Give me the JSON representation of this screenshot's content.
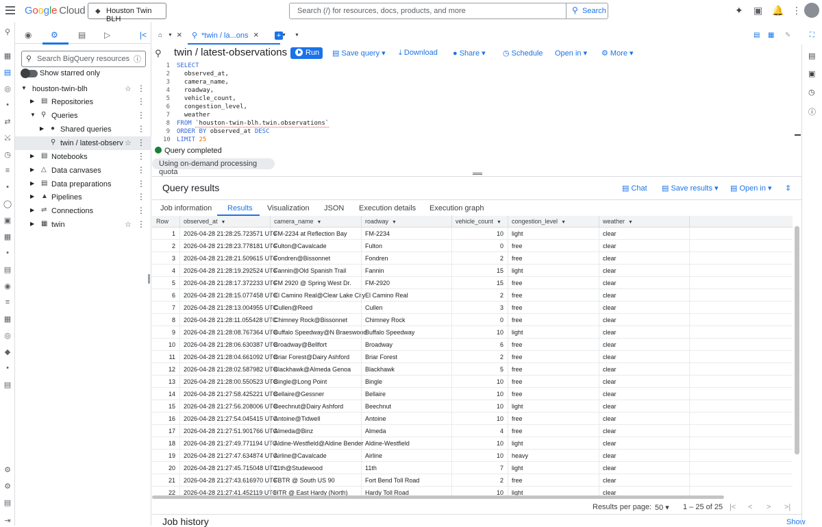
{
  "app": {
    "brand": "Google Cloud",
    "project_button": "Houston Twin BLH",
    "search_placeholder": "Search (/) for resources, docs, products, and more",
    "search_button": "Search"
  },
  "explorer": {
    "search_placeholder": "Search BigQuery resources",
    "show_starred": "Show starred only",
    "tree": [
      {
        "label": "houston-twin-blh",
        "starred": true
      },
      {
        "label": "Repositories"
      },
      {
        "label": "Queries"
      },
      {
        "label": "Shared queries"
      },
      {
        "label": "twin / latest-observatio",
        "starred": true,
        "selected": true
      },
      {
        "label": "Notebooks"
      },
      {
        "label": "Data canvases"
      },
      {
        "label": "Data preparations"
      },
      {
        "label": "Pipelines"
      },
      {
        "label": "Connections"
      },
      {
        "label": "twin",
        "starred": true
      }
    ]
  },
  "editor": {
    "tab_label": "*twin / la...ons",
    "query_title": "twin / latest-observations",
    "run": "Run",
    "save_query": "Save query",
    "download": "Download",
    "share": "Share",
    "schedule": "Schedule",
    "open_in": "Open in",
    "more": "More",
    "code": [
      "SELECT",
      "  observed_at,",
      "  camera_name,",
      "  roadway,",
      "  vehicle_count,",
      "  congestion_level,",
      "  weather",
      "FROM `houston-twin-blh.twin.observations`",
      "ORDER BY observed_at DESC",
      "LIMIT 25"
    ],
    "status": "Query completed",
    "quota": "Using on-demand processing quota"
  },
  "results": {
    "title": "Query results",
    "chat": "Chat",
    "save_results": "Save results",
    "open_in": "Open in",
    "tabs": [
      "Job information",
      "Results",
      "Visualization",
      "JSON",
      "Execution details",
      "Execution graph"
    ],
    "columns": [
      "Row",
      "observed_at",
      "camera_name",
      "roadway",
      "vehicle_count",
      "congestion_level",
      "weather"
    ],
    "rows": [
      [
        "1",
        "2026-04-28 21:28:25.723571 UTC",
        "FM-2234 at Reflection Bay",
        "FM-2234",
        "10",
        "light",
        "clear"
      ],
      [
        "2",
        "2026-04-28 21:28:23.778181 UTC",
        "Fulton@Cavalcade",
        "Fulton",
        "0",
        "free",
        "clear"
      ],
      [
        "3",
        "2026-04-28 21:28:21.509615 UTC",
        "Fondren@Bissonnet",
        "Fondren",
        "2",
        "free",
        "clear"
      ],
      [
        "4",
        "2026-04-28 21:28:19.292524 UTC",
        "Fannin@Old Spanish Trail",
        "Fannin",
        "15",
        "light",
        "clear"
      ],
      [
        "5",
        "2026-04-28 21:28:17.372233 UTC",
        "FM 2920 @ Spring West Dr.",
        "FM-2920",
        "15",
        "free",
        "clear"
      ],
      [
        "6",
        "2026-04-28 21:28:15.077458 UTC",
        "El Camino Real@Clear Lake City",
        "El Camino Real",
        "2",
        "free",
        "clear"
      ],
      [
        "7",
        "2026-04-28 21:28:13.004955 UTC",
        "Cullen@Reed",
        "Cullen",
        "3",
        "free",
        "clear"
      ],
      [
        "8",
        "2026-04-28 21:28:11.055428 UTC",
        "Chimney Rock@Bissonnet",
        "Chimney Rock",
        "0",
        "free",
        "clear"
      ],
      [
        "9",
        "2026-04-28 21:28:08.767364 UTC",
        "Buffalo Speedway@N Braeswood",
        "Buffalo Speedway",
        "10",
        "light",
        "clear"
      ],
      [
        "10",
        "2026-04-28 21:28:06.630387 UTC",
        "Broadway@Bellfort",
        "Broadway",
        "6",
        "free",
        "clear"
      ],
      [
        "11",
        "2026-04-28 21:28:04.661092 UTC",
        "Briar Forest@Dairy Ashford",
        "Briar Forest",
        "2",
        "free",
        "clear"
      ],
      [
        "12",
        "2026-04-28 21:28:02.587982 UTC",
        "Blackhawk@Almeda Genoa",
        "Blackhawk",
        "5",
        "free",
        "clear"
      ],
      [
        "13",
        "2026-04-28 21:28:00.550523 UTC",
        "Bingle@Long Point",
        "Bingle",
        "10",
        "free",
        "clear"
      ],
      [
        "14",
        "2026-04-28 21:27:58.425221 UTC",
        "Bellaire@Gessner",
        "Bellaire",
        "10",
        "free",
        "clear"
      ],
      [
        "15",
        "2026-04-28 21:27:56.208006 UTC",
        "Beechnut@Dairy Ashford",
        "Beechnut",
        "10",
        "light",
        "clear"
      ],
      [
        "16",
        "2026-04-28 21:27:54.045415 UTC",
        "Antoine@Tidwell",
        "Antoine",
        "10",
        "free",
        "clear"
      ],
      [
        "17",
        "2026-04-28 21:27:51.901766 UTC",
        "Almeda@Binz",
        "Almeda",
        "4",
        "free",
        "clear"
      ],
      [
        "18",
        "2026-04-28 21:27:49.771194 UTC",
        "Aldine-Westfield@Aldine Bender",
        "Aldine-Westfield",
        "10",
        "light",
        "clear"
      ],
      [
        "19",
        "2026-04-28 21:27:47.634874 UTC",
        "Airline@Cavalcade",
        "Airline",
        "10",
        "heavy",
        "clear"
      ],
      [
        "20",
        "2026-04-28 21:27:45.715048 UTC",
        "11th@Studewood",
        "11th",
        "7",
        "light",
        "clear"
      ],
      [
        "21",
        "2026-04-28 21:27:43.616970 UTC",
        "FBTR @ South US 90",
        "Fort Bend Toll Road",
        "2",
        "free",
        "clear"
      ],
      [
        "22",
        "2026-04-28 21:27:41.452119 UTC",
        "HTR @ East Hardy (North)",
        "Hardy Toll Road",
        "10",
        "light",
        "clear"
      ]
    ],
    "per_page_label": "Results per page:",
    "per_page": "50",
    "range": "1 – 25 of 25"
  },
  "job_history": {
    "title": "Job history",
    "show": "Show"
  }
}
